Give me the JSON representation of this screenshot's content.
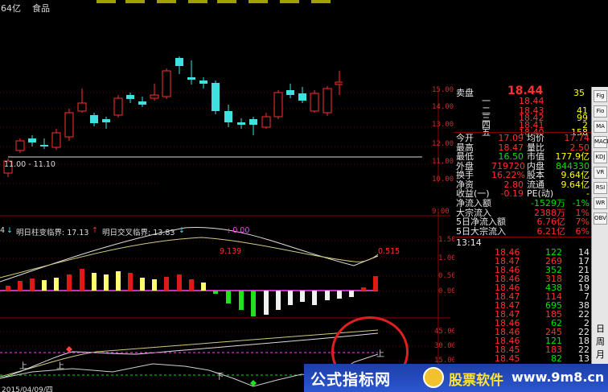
{
  "title_bar": {
    "cap": "64亿",
    "name": "食品"
  },
  "range_label": "11.00 - 11.10",
  "price_axis": [
    "14.00",
    "13.00",
    "12.00",
    "11.00",
    "10.00"
  ],
  "price_axis_full": [
    "15.00",
    "14.00",
    "13.00",
    "12.00",
    "11.00",
    "10.00"
  ],
  "indicator1": {
    "prefix": "4",
    "label_a": "明日柱变临界: 17.13",
    "label_b": "明日交叉临界: 13.83",
    "tail": ": 0.00",
    "value_a": "9.139",
    "value_b": "0.515",
    "axis": [
      "1.50",
      "1.00",
      "0.50",
      "0.00"
    ]
  },
  "indicator2": {
    "axis": [
      "45.00",
      "30.00",
      "15.00"
    ],
    "up_char": "上",
    "down_char": "下"
  },
  "date_label": "2015/04/09/四",
  "order_book": {
    "sell_title": "卖盘",
    "top_price": "18.44",
    "top_vol": "35",
    "sells": [
      {
        "label": "一",
        "price": "18.44",
        "vol": ""
      },
      {
        "label": "二",
        "price": "18.43",
        "vol": "41"
      },
      {
        "label": "三",
        "price": "18.42",
        "vol": "99"
      },
      {
        "label": "四",
        "price": "18.41",
        "vol": "2"
      },
      {
        "label": "五",
        "price": "18.40",
        "vol": "158"
      }
    ]
  },
  "stats": [
    {
      "k1": "今开",
      "v1": "17.09",
      "k2": "均价",
      "v2": "17.74"
    },
    {
      "k1": "最高",
      "v1": "18.47",
      "k2": "量比",
      "v2": "2.50"
    },
    {
      "k1": "最低",
      "v1": "16.50",
      "k2": "市值",
      "v2": "177.9亿"
    },
    {
      "k1": "外盘",
      "v1": "719720",
      "k2": "内盘",
      "v2": "844330"
    },
    {
      "k1": "换手",
      "v1": "16.22%",
      "k2": "股本",
      "v2": "9.64亿"
    },
    {
      "k1": "净资",
      "v1": "2.80",
      "k2": "流通",
      "v2": "9.64亿"
    },
    {
      "k1": "收益(一)",
      "v1": "-0.19",
      "k2": "PE(动)",
      "v2": "-"
    }
  ],
  "flows": [
    {
      "k": "净流入额",
      "v": "-1529万",
      "p": "-1%"
    },
    {
      "k": "大宗流入",
      "v": "2388万",
      "p": "1%"
    },
    {
      "k": "5日净流入额",
      "v": "6.76亿",
      "p": "7%"
    },
    {
      "k": "5日大宗流入",
      "v": "6.21亿",
      "p": "6%"
    }
  ],
  "ticks": {
    "time": "13:14",
    "rows": [
      {
        "p": "18.46",
        "v": "122",
        "c": "14"
      },
      {
        "p": "18.47",
        "v": "269",
        "c": "17"
      },
      {
        "p": "18.46",
        "v": "352",
        "c": "21"
      },
      {
        "p": "18.46",
        "v": "318",
        "c": "28"
      },
      {
        "p": "18.46",
        "v": "438",
        "c": "19"
      },
      {
        "p": "18.47",
        "v": "114",
        "c": "7"
      },
      {
        "p": "18.47",
        "v": "695",
        "c": "38"
      },
      {
        "p": "18.47",
        "v": "185",
        "c": "22"
      },
      {
        "p": "18.46",
        "v": "62",
        "c": "2"
      },
      {
        "p": "18.46",
        "v": "245",
        "c": "22"
      },
      {
        "p": "18.46",
        "v": "121",
        "c": "18"
      },
      {
        "p": "18.45",
        "v": "183",
        "c": "22"
      },
      {
        "p": "18.45",
        "v": "82",
        "c": "13"
      }
    ]
  },
  "sidebar": {
    "buttons": [
      "Fig",
      "Fio",
      "MA",
      "MACD",
      "KDJ",
      "VR",
      "RSI",
      "WR",
      "OBV"
    ],
    "chars": [
      "日",
      "周",
      "月"
    ]
  },
  "banner": {
    "text1": "公式指标网",
    "text2": "股票软件",
    "text3": "www.9m8.cn"
  },
  "colors": {
    "up": "#ff3030",
    "down": "#40e0e0",
    "yellow": "#ffff00",
    "green": "#00e000",
    "magenta": "#ff40ff"
  }
}
